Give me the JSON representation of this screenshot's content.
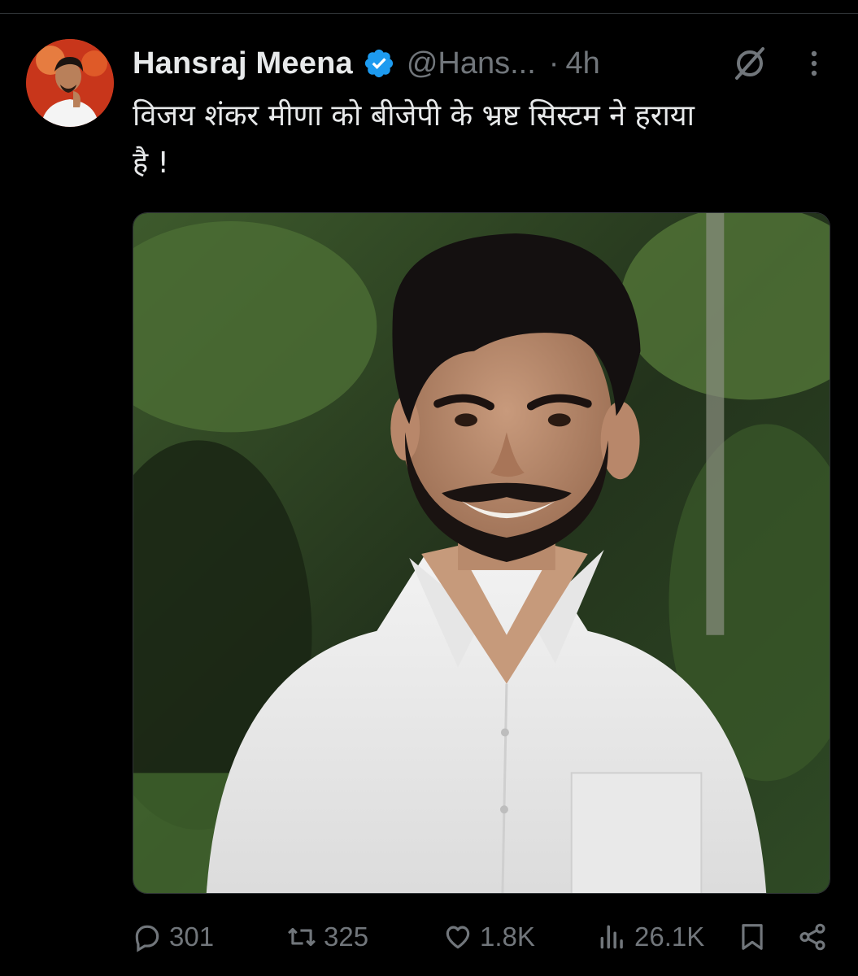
{
  "author": {
    "name": "Hansraj Meena",
    "handle": "@Hans...",
    "separator": "·",
    "time": "4h"
  },
  "tweet": {
    "line1": "विजय शंकर मीणा को बीजेपी के भ्रष्ट सिस्टम ने हराया",
    "line2": "है !"
  },
  "actions": {
    "replies": "301",
    "reposts": "325",
    "likes": "1.8K",
    "views": "26.1K"
  },
  "icons": {
    "verified": "verified-badge-icon",
    "grok": "grok-icon",
    "more": "more-vertical-icon",
    "reply": "reply-icon",
    "repost": "repost-icon",
    "like": "heart-icon",
    "views": "views-chart-icon",
    "bookmark": "bookmark-icon",
    "share": "share-icon"
  },
  "colors": {
    "background": "#000000",
    "text": "#e7e9ea",
    "secondary": "#71767b",
    "verified": "#1d9bf0"
  }
}
